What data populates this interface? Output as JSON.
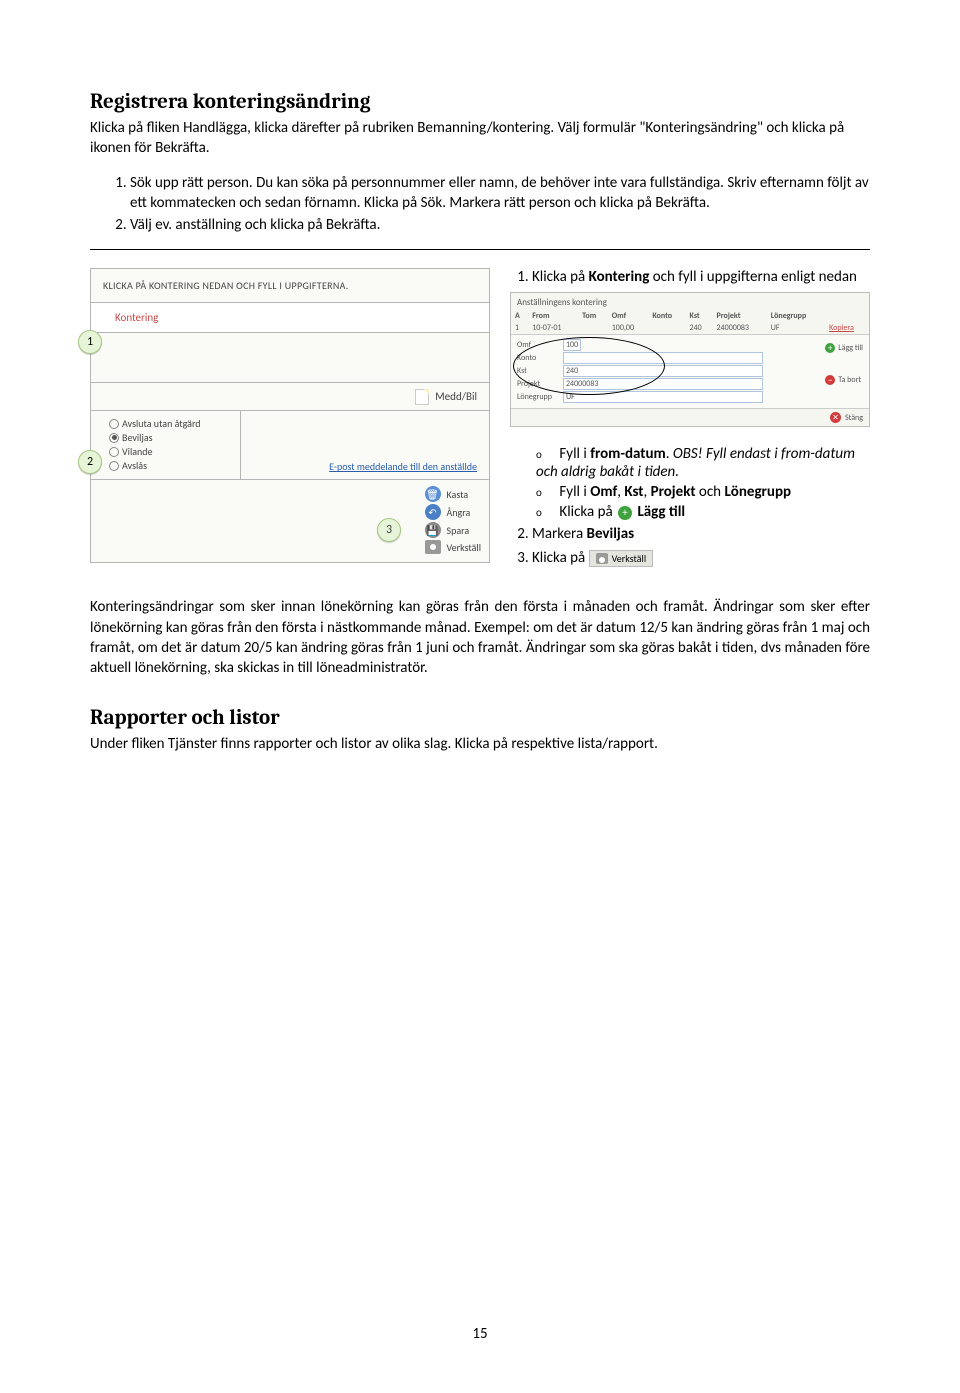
{
  "heading1": "Registrera konteringsändring",
  "intro_p1": "Klicka på fliken Handlägga, klicka därefter på rubriken Bemanning/kontering. Välj formulär \"Konteringsändring\" och klicka på ikonen för Bekräfta.",
  "steps1": {
    "li1_pre": "Sök upp rätt person. Du kan söka på personnummer eller namn, de behöver inte vara fullständiga. Skriv efternamn följt av ett kommatecken och sedan förnamn. Klicka på Sök. Markera rätt person och klicka på Bekräfta.",
    "li2": "Välj ev. anställning och klicka på Bekräfta."
  },
  "left_panel": {
    "banner": "KLICKA PÅ KONTERING NEDAN OCH FYLL I UPPGIFTERNA.",
    "kontering_link": "Kontering",
    "meddbil": "Medd/Bil",
    "radio": {
      "r1": "Avsluta utan åtgärd",
      "r2": "Beviljas",
      "r3": "Vilande",
      "r4": "Avslås"
    },
    "email_link": "E-post meddelande till den anställde",
    "btns": {
      "kasta": "Kasta",
      "angra": "Ångra",
      "spara": "Spara",
      "verkstall": "Verkställ"
    }
  },
  "right_intro_pre": "Klicka på ",
  "right_intro_bold": "Kontering",
  "right_intro_post": " och fyll i uppgifterna enligt nedan",
  "kontpanel": {
    "header": "Anställningens kontering",
    "th": {
      "a": "A",
      "from": "From",
      "tom": "Tom",
      "omf": "Omf",
      "konto": "Konto",
      "kst": "Kst",
      "projekt": "Projekt",
      "lonegrupp": "Lönegrupp"
    },
    "row": {
      "n": "1",
      "from": "10-07-01",
      "tom": "",
      "omf": "100,00",
      "konto": "",
      "kst": "240",
      "projekt": "24000083",
      "lonegrupp": "UF"
    },
    "kopiera": "Kopiera",
    "form": {
      "omf_label": "Omf",
      "omf_val": "100",
      "konto_label": "Konto",
      "kst_label": "Kst",
      "kst_val": "240",
      "projekt_label": "Projekt",
      "projekt_val": "24000083",
      "lon_label": "Lönegrupp",
      "lon_val": "UF"
    },
    "lagg_till": "Lägg till",
    "ta_bort": "Ta bort",
    "stang": "Stäng"
  },
  "right_list": {
    "b1a": "Fyll i ",
    "b1b": "from-datum",
    "b1c": ". ",
    "b1d": "OBS! Fyll endast i from-datum och aldrig bakåt i tiden.",
    "b2a": "Fyll i ",
    "b2b": "Omf",
    "b2c": ", ",
    "b2d": "Kst",
    "b2e": ", ",
    "b2f": "Projekt",
    "b2g": " och ",
    "b2h": "Lönegrupp",
    "b3a": "Klicka på ",
    "b3b": "Lägg till",
    "li2a": "Markera ",
    "li2b": "Beviljas",
    "li3a": "Klicka på ",
    "verkstall_label": "Verkställ"
  },
  "after_para": "Konteringsändringar som sker innan lönekörning kan göras från den första i månaden och framåt. Ändringar som sker efter lönekörning kan göras från den första i nästkommande månad. Exempel: om det är datum 12/5 kan ändring göras från 1 maj och framåt, om det är datum 20/5 kan ändring göras från 1 juni och framåt. Ändringar som ska göras bakåt i tiden, dvs månaden före aktuell lönekörning, ska skickas in till löneadministratör.",
  "heading2": "Rapporter och listor",
  "end_para": "Under fliken Tjänster finns rapporter och listor av olika slag. Klicka på respektive lista/rapport.",
  "badges": {
    "b1": "1",
    "b2": "2",
    "b3": "3"
  },
  "page_number": "15"
}
